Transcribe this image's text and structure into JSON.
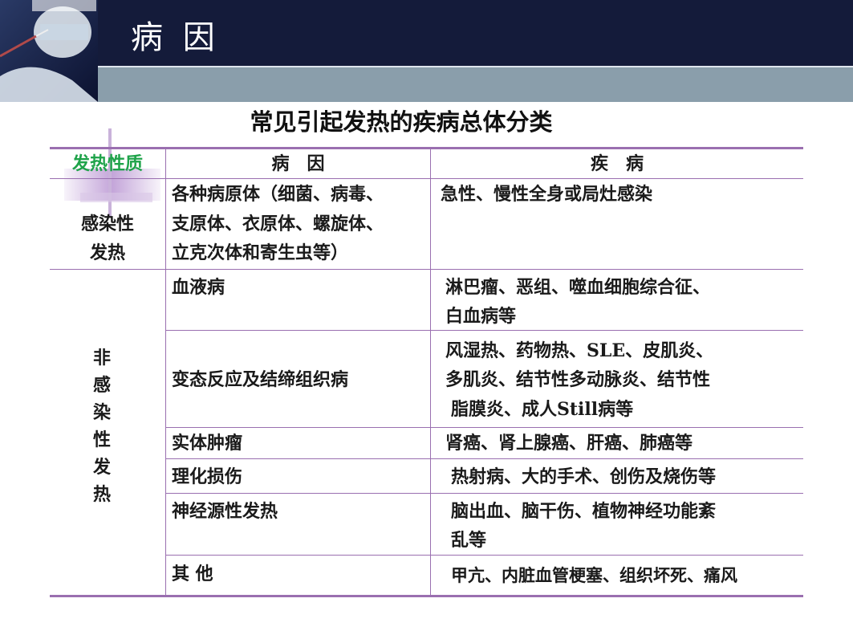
{
  "slide": {
    "title": "病 因"
  },
  "table": {
    "title": "常见引起发热的疾病总体分类",
    "headers": {
      "nature": "发热性质",
      "cause": "病　因",
      "disease": "疾　病"
    },
    "infectious": {
      "label_line1": "感染性",
      "label_line2": "发热",
      "cause_lines": [
        "各种病原体（细菌、病毒、",
        "支原体、衣原体、螺旋体、",
        "立克次体和寄生虫等）"
      ],
      "disease": "急性、慢性全身或局灶感染"
    },
    "noninfectious": {
      "label_chars": [
        "非",
        "感",
        "染",
        "性",
        "发",
        "热"
      ],
      "rows": [
        {
          "cause": "血液病",
          "disease_lines": [
            "淋巴瘤、恶组、噬血细胞综合征、",
            "白血病等"
          ]
        },
        {
          "cause": "变态反应及结缔组织病",
          "disease_lines": [
            "风湿热、药物热、SLE、皮肌炎、",
            "多肌炎、结节性多动脉炎、结节性",
            "脂膜炎、成人Still病等"
          ]
        },
        {
          "cause": "实体肿瘤",
          "disease_lines": [
            "肾癌、肾上腺癌、肝癌、肺癌等"
          ]
        },
        {
          "cause": "理化损伤",
          "disease_lines": [
            "热射病、大的手术、创伤及烧伤等"
          ]
        },
        {
          "cause": "神经源性发热",
          "disease_lines": [
            "脑出血、脑干伤、植物神经功能紊",
            "乱等"
          ]
        },
        {
          "cause": "其 他",
          "disease_lines": [
            "甲亢、内脏血管梗塞、组织坏死、痛风"
          ]
        }
      ]
    }
  }
}
